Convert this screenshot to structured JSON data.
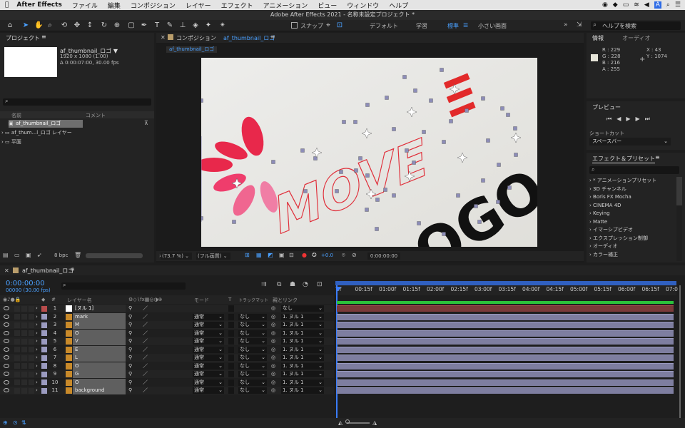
{
  "menubar": {
    "apple": "",
    "app": "After Effects",
    "items": [
      "ファイル",
      "編集",
      "コンポジション",
      "レイヤー",
      "エフェクト",
      "アニメーション",
      "ビュー",
      "ウィンドウ",
      "ヘルプ"
    ],
    "status_a": "A"
  },
  "window_title": "Adobe After Effects 2021 - 名称未設定プロジェクト *",
  "toolbar": {
    "snap_label": "スナップ",
    "workspaces": [
      "デフォルト",
      "学習",
      "標準",
      "小さい画面"
    ],
    "active_workspace": "標準",
    "search_placeholder": "ヘルプを検索"
  },
  "project": {
    "title": "プロジェクト",
    "thumb_name": "af_thumbnail_ロゴ ▼",
    "thumb_info1": "1920 x 1080 (1.00)",
    "thumb_info2": "Δ 0:00:07:00, 30.00 fps",
    "col_name": "名前",
    "col_comment": "コメント",
    "items": [
      "af_thumbnail_ロゴ",
      "af_thum...l_ロゴ レイヤー",
      "平面"
    ],
    "bpc": "8 bpc"
  },
  "composition": {
    "tab_label": "コンポジション",
    "comp_name": "af_thumbnail_ロゴ",
    "chip": "af_thumbnail_ロゴ",
    "zoom": "(73.7 %)",
    "quality": "(フル画質)",
    "exposure": "+0.0",
    "timecode": "0:00:00:00",
    "logo_text": "LOGO",
    "move_text": "MOVE"
  },
  "info": {
    "tab": "情報",
    "tab2": "オーディオ",
    "r": "R : 229",
    "g": "G : 228",
    "b": "B : 216",
    "a": "A : 255",
    "x": "X : 43",
    "y": "Y : 1074"
  },
  "preview": {
    "title": "プレビュー",
    "shortcut_label": "ショートカット",
    "shortcut_value": "スペースバー"
  },
  "effects": {
    "title": "エフェクト＆プリセット",
    "items": [
      "* アニメーションプリセット",
      "3D チャンネル",
      "Boris FX Mocha",
      "CINEMA 4D",
      "Keying",
      "Matte",
      "イマーシブビデオ",
      "エクスプレッション制御",
      "オーディオ",
      "カラー補正"
    ]
  },
  "timeline": {
    "tab": "af_thumbnail_ロゴ",
    "timecode": "0:00:00:00",
    "frames": "00000 (30.00 fps)",
    "search_icon": "search-icon",
    "col_num": "#",
    "col_name": "レイヤー名",
    "col_mode": "モード",
    "col_t": "T",
    "col_track": "トラックマット",
    "col_parent": "親とリンク",
    "ruler": [
      "0f",
      "00:15f",
      "01:00f",
      "01:15f",
      "02:00f",
      "02:15f",
      "03:00f",
      "03:15f",
      "04:00f",
      "04:15f",
      "05:00f",
      "05:15f",
      "06:00f",
      "06:15f",
      "07:0"
    ],
    "layers": [
      {
        "num": "1",
        "name": "[ヌル 1]",
        "color": "#b84c4c",
        "mode": "",
        "track": "",
        "parent": "なし",
        "type": "null"
      },
      {
        "num": "2",
        "name": "mark",
        "color": "#9b9bc0",
        "mode": "通常",
        "track": "なし",
        "parent": "1. ヌル 1",
        "type": "shape"
      },
      {
        "num": "3",
        "name": "M",
        "color": "#9b9bc0",
        "mode": "通常",
        "track": "なし",
        "parent": "1. ヌル 1",
        "type": "shape"
      },
      {
        "num": "4",
        "name": "O",
        "color": "#9b9bc0",
        "mode": "通常",
        "track": "なし",
        "parent": "1. ヌル 1",
        "type": "shape"
      },
      {
        "num": "5",
        "name": "V",
        "color": "#9b9bc0",
        "mode": "通常",
        "track": "なし",
        "parent": "1. ヌル 1",
        "type": "shape"
      },
      {
        "num": "6",
        "name": "E",
        "color": "#9b9bc0",
        "mode": "通常",
        "track": "なし",
        "parent": "1. ヌル 1",
        "type": "shape"
      },
      {
        "num": "7",
        "name": "L",
        "color": "#9b9bc0",
        "mode": "通常",
        "track": "なし",
        "parent": "1. ヌル 1",
        "type": "shape"
      },
      {
        "num": "8",
        "name": "O",
        "color": "#9b9bc0",
        "mode": "通常",
        "track": "なし",
        "parent": "1. ヌル 1",
        "type": "shape"
      },
      {
        "num": "9",
        "name": "G",
        "color": "#9b9bc0",
        "mode": "通常",
        "track": "なし",
        "parent": "1. ヌル 1",
        "type": "shape"
      },
      {
        "num": "10",
        "name": "O",
        "color": "#9b9bc0",
        "mode": "通常",
        "track": "なし",
        "parent": "1. ヌル 1",
        "type": "shape"
      },
      {
        "num": "11",
        "name": "background",
        "color": "#9b9bc0",
        "mode": "通常",
        "track": "なし",
        "parent": "1. ヌル 1",
        "type": "shape"
      }
    ]
  }
}
